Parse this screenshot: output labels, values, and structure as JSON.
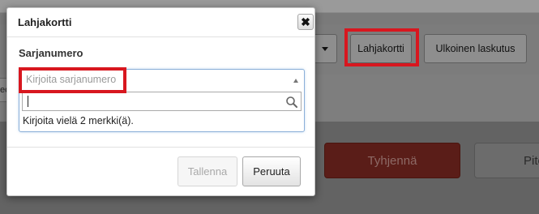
{
  "background": {
    "toolbar": {
      "giftcard_label": "Lahjakortti",
      "external_billing_label": "Ulkoinen laskutus"
    },
    "side_field_text": "ec",
    "clear_button_label": "Tyhjennä",
    "right_button_label": "Pito"
  },
  "modal": {
    "title": "Lahjakortti",
    "close_symbol": "✖",
    "field_label": "Sarjanumero",
    "select": {
      "placeholder": "Kirjoita sarjanumero",
      "search_value": ""
    },
    "hint": "Kirjoita vielä 2 merkki(ä).",
    "footer": {
      "save_label": "Tallenna",
      "cancel_label": "Peruuta"
    }
  },
  "colors": {
    "highlight": "#d8171f",
    "clear_button": "#5a1d18",
    "focus_border": "#8cb0d8"
  }
}
